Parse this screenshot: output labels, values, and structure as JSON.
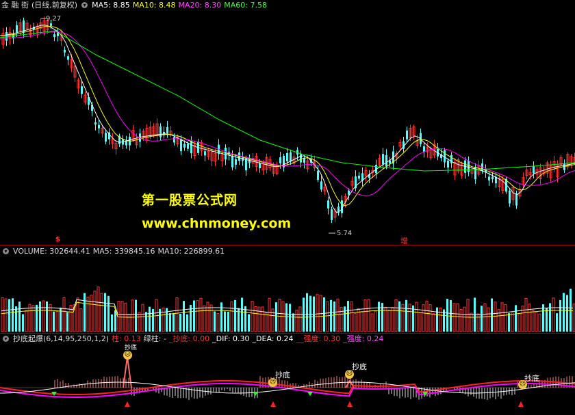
{
  "price_header": {
    "app_name": "金 融 街",
    "period": "(日线,前复权)",
    "ma5": "MA5: 8.85",
    "ma10": "MA10: 8.48",
    "ma20": "MA20: 8.30",
    "ma60": "MA60: 7.58",
    "high_label": "9.27",
    "low_label": "5.74",
    "marker_s": "$",
    "marker_add": "增"
  },
  "watermark": {
    "line1": "第一股票公式网",
    "line2": "www.chnmoney.com"
  },
  "volume_header": {
    "volume": "VOLUME: 302644.41",
    "ma5": "MA5: 339845.16",
    "ma10": "MA10: 226899.61"
  },
  "indicator_header": {
    "name": "抄底起爆(6,14,95,250,1,2)",
    "zhu": "柱: 0.13",
    "lvzhu": "绿柱: -",
    "chaodi": "_抄底: 0.00",
    "dif": "_DIF: 0.30",
    "dea": "_DEA: 0.24",
    "qiangdu_1": "__强度: 0.30",
    "qiangdu_2": "_强度: 0.24"
  },
  "signals": {
    "s1": "抄底",
    "s2": "抄底",
    "s3": "抄底",
    "s4": "抄底",
    "s5": "抄底"
  },
  "colors": {
    "up": "#ff3232",
    "down": "#54ffff",
    "ma5": "#ffffff",
    "ma10": "#ffff00",
    "ma20": "#ff00ff",
    "ma60": "#00ff00",
    "separator": "#a00000"
  }
}
